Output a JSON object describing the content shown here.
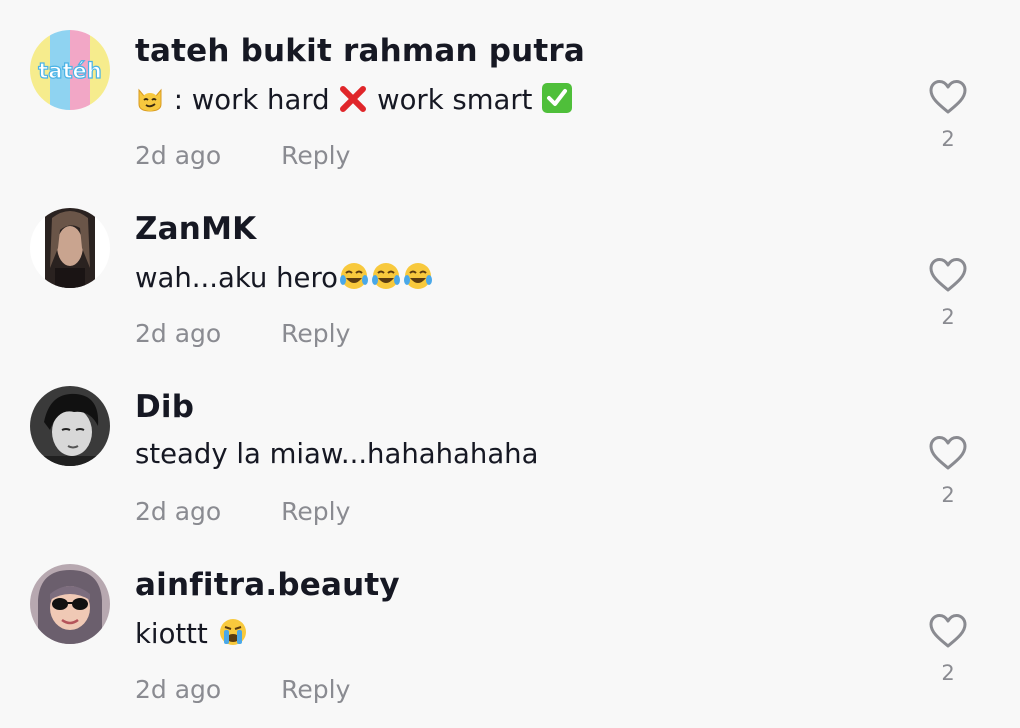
{
  "comments": [
    {
      "username": "tateh bukit rahman putra",
      "text_parts": [
        ": work hard",
        "work smart"
      ],
      "time": "2d ago",
      "reply_label": "Reply",
      "likes": "2",
      "avatar_text": "tatéh"
    },
    {
      "username": "ZanMK",
      "text": "wah...aku hero",
      "time": "2d ago",
      "reply_label": "Reply",
      "likes": "2"
    },
    {
      "username": "Dib",
      "text": "steady la miaw...hahahahaha",
      "time": "2d ago",
      "reply_label": "Reply",
      "likes": "2"
    },
    {
      "username": "ainfitra.beauty",
      "text": "kiottt",
      "time": "2d ago",
      "reply_label": "Reply",
      "likes": "2"
    }
  ],
  "icons": {
    "like": "heart-outline-icon",
    "emojis": [
      "smirking-cat-emoji",
      "cross-mark-emoji",
      "check-mark-button-emoji",
      "tears-of-joy-emoji",
      "loudly-crying-emoji"
    ]
  },
  "colors": {
    "background": "#f8f8f8",
    "username": "#161823",
    "meta": "#8a8b91",
    "heart": "#8a8b91"
  }
}
